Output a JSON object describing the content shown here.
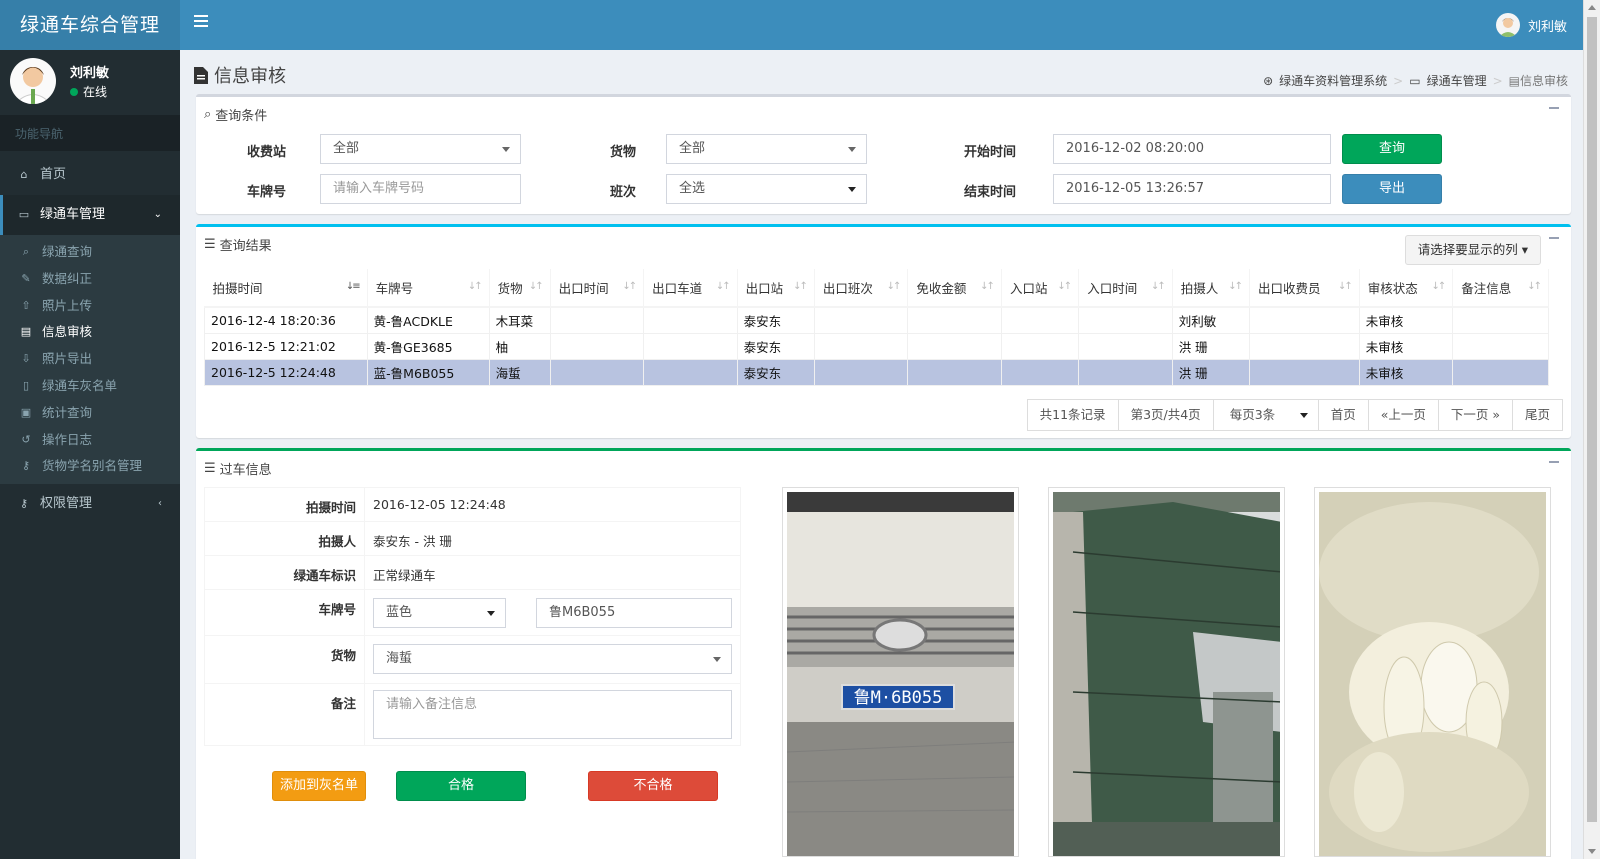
{
  "app": {
    "logo": "绿通车综合管理",
    "user": "刘利敏"
  },
  "sidebar": {
    "user_name": "刘利敏",
    "status": "在线",
    "nav_header": "功能导航",
    "home": "首页",
    "group": "绿通车管理",
    "items": [
      "绿通查询",
      "数据纠正",
      "照片上传",
      "信息审核",
      "照片导出",
      "绿通车灰名单",
      "统计查询",
      "操作日志",
      "货物学名别名管理"
    ],
    "permissions": "权限管理"
  },
  "page": {
    "title": "信息审核"
  },
  "breadcrumb": {
    "root": "绿通车资料管理系统",
    "mid": "绿通车管理",
    "current": "信息审核"
  },
  "query": {
    "title": "查询条件",
    "station_label": "收费站",
    "station_value": "全部",
    "goods_label": "货物",
    "goods_value": "全部",
    "start_label": "开始时间",
    "start_value": "2016-12-02 08:20:00",
    "plate_label": "车牌号",
    "plate_placeholder": "请输入车牌号码",
    "shift_label": "班次",
    "shift_value": "全选",
    "end_label": "结束时间",
    "end_value": "2016-12-05 13:26:57",
    "search_btn": "查询",
    "export_btn": "导出"
  },
  "results": {
    "title": "查询结果",
    "col_select": "请选择要显示的列",
    "columns": [
      "拍摄时间",
      "车牌号",
      "货物",
      "出口时间",
      "出口车道",
      "出口站",
      "出口班次",
      "免收金额",
      "入口站",
      "入口时间",
      "拍摄人",
      "出口收费员",
      "审核状态",
      "备注信息"
    ],
    "rows": [
      [
        "2016-12-4 18:20:36",
        "黄-鲁ACDKLE",
        "木耳菜",
        "",
        "",
        "泰安东",
        "",
        "",
        "",
        "",
        "刘利敏",
        "",
        "未审核",
        ""
      ],
      [
        "2016-12-5 12:21:02",
        "黄-鲁GE3685",
        "柚",
        "",
        "",
        "泰安东",
        "",
        "",
        "",
        "",
        "洪 珊",
        "",
        "未审核",
        ""
      ],
      [
        "2016-12-5 12:24:48",
        "蓝-鲁M6B055",
        "海蜇",
        "",
        "",
        "泰安东",
        "",
        "",
        "",
        "",
        "洪 珊",
        "",
        "未审核",
        ""
      ]
    ],
    "pager": {
      "total": "共11条记录",
      "page": "第3页/共4页",
      "per_page": "每页3条",
      "first": "首页",
      "prev": "«上一页",
      "next": "下一页 »",
      "last": "尾页"
    }
  },
  "detail": {
    "title": "过车信息",
    "time_label": "拍摄时间",
    "time_value": "2016-12-05 12:24:48",
    "shooter_label": "拍摄人",
    "shooter_value": "泰安东 - 洪 珊",
    "flag_label": "绿通车标识",
    "flag_value": "正常绿通车",
    "plate_label": "车牌号",
    "plate_color": "蓝色",
    "plate_value": "鲁M6B055",
    "goods_label": "货物",
    "goods_value": "海蜇",
    "remark_label": "备注",
    "remark_placeholder": "请输入备注信息",
    "btn_gray": "添加到灰名单",
    "btn_pass": "合格",
    "btn_fail": "不合格",
    "plate_text": "鲁M·6B055"
  },
  "colors": {
    "header": "#3c8dbc",
    "logo": "#367fa9",
    "sidebar": "#222d32",
    "green": "#00a65a",
    "red": "#dd4b39",
    "orange": "#f39c12"
  }
}
